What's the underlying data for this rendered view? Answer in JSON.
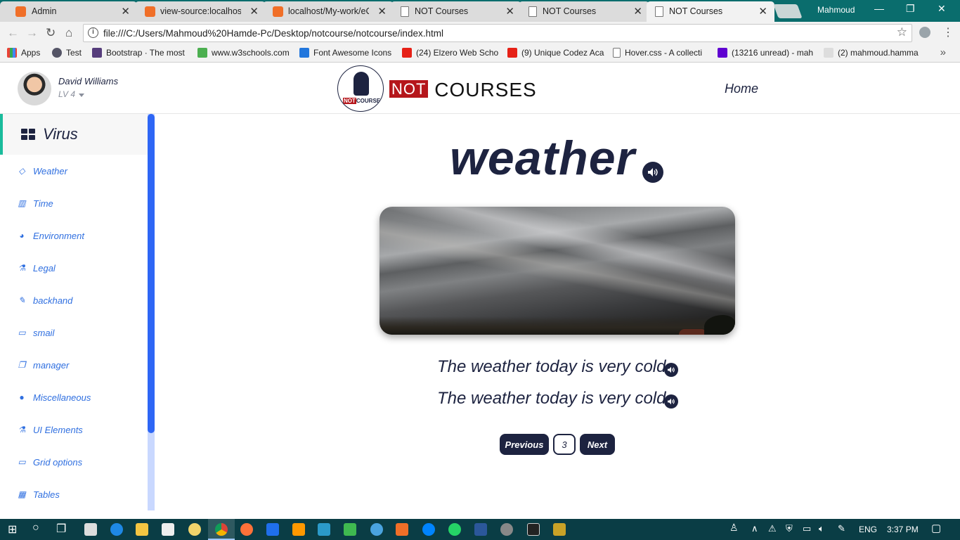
{
  "browser": {
    "tabs": [
      {
        "title": "Admin",
        "icon": "xampp-icon"
      },
      {
        "title": "view-source:localhost/",
        "icon": "xampp-icon"
      },
      {
        "title": "localhost/My-work/eC",
        "icon": "xampp-icon"
      },
      {
        "title": "NOT Courses",
        "icon": "page-icon"
      },
      {
        "title": "NOT Courses",
        "icon": "page-icon"
      },
      {
        "title": "NOT Courses",
        "icon": "page-icon"
      }
    ],
    "active_tab": 5,
    "profile_name": "Mahmoud",
    "url": "file:///C:/Users/Mahmoud%20Hamde-Pc/Desktop/notcourse/notcourse/index.html",
    "bookmarks": [
      {
        "label": "Apps"
      },
      {
        "label": "Test"
      },
      {
        "label": "Bootstrap · The most"
      },
      {
        "label": "www.w3schools.com"
      },
      {
        "label": "Font Awesome Icons"
      },
      {
        "label": "(24) Elzero Web Scho"
      },
      {
        "label": "(9) Unique Codez Aca"
      },
      {
        "label": "Hover.css - A collecti"
      },
      {
        "label": "(13216 unread) - mah"
      },
      {
        "label": "(2) mahmoud.hamma"
      }
    ],
    "bookmarks_more": "»"
  },
  "header": {
    "user_name": "David Williams",
    "user_level": "LV 4",
    "brand_not": "NOT",
    "brand_courses": "COURSES",
    "logo_mini_not": "NOT",
    "logo_mini_courses": "COURSES",
    "nav_home": "Home"
  },
  "sidebar": {
    "title": "Virus",
    "items": [
      {
        "label": "Weather",
        "icon": "diamond-icon"
      },
      {
        "label": "Time",
        "icon": "bar-chart-icon"
      },
      {
        "label": "Environment",
        "icon": "pie-chart-icon"
      },
      {
        "label": "Legal",
        "icon": "flask-icon"
      },
      {
        "label": "backhand",
        "icon": "edit-icon"
      },
      {
        "label": "smail",
        "icon": "desktop-icon"
      },
      {
        "label": "manager",
        "icon": "copy-icon"
      },
      {
        "label": "Miscellaneous",
        "icon": "globe-icon"
      },
      {
        "label": "UI Elements",
        "icon": "flask-icon"
      },
      {
        "label": "Grid options",
        "icon": "laptop-icon"
      },
      {
        "label": "Tables",
        "icon": "table-icon"
      }
    ]
  },
  "lesson": {
    "word": "weather",
    "sentences": [
      "The weather today is very cold",
      "The weather today is very cold"
    ],
    "pagination": {
      "previous_label": "Previous",
      "current_page": "3",
      "next_label": "Next"
    }
  },
  "taskbar": {
    "language": "ENG",
    "time": "3:37 PM"
  },
  "colors": {
    "navy": "#1d2340",
    "sidebar_link": "#2f6fe0",
    "sidebar_accent": "#1abc9c",
    "scrollbar_thumb": "#2e66f5",
    "brand_red": "#b5161b",
    "tabbar": "#0a6d6d",
    "taskbar": "#0a3d45"
  }
}
